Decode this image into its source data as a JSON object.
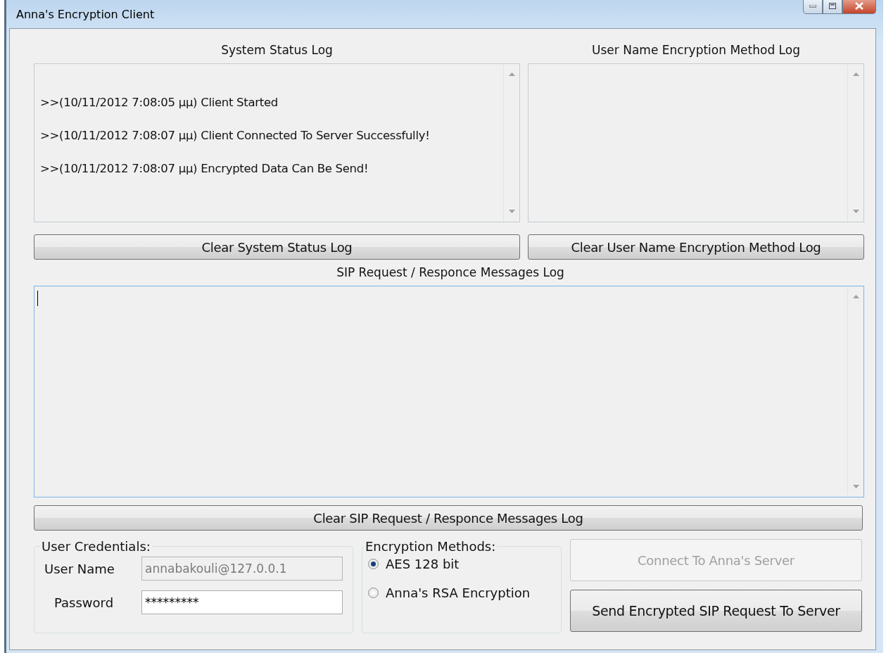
{
  "window": {
    "title": "Anna's Encryption Client"
  },
  "system_log": {
    "title": "System Status Log",
    "lines": [
      ">>(10/11/2012 7:08:05 μμ) Client Started",
      ">>(10/11/2012 7:08:07 μμ) Client Connected To Server Successfully!",
      ">>(10/11/2012 7:08:07 μμ) Encrypted Data Can Be Send!"
    ],
    "clear_button": "Clear System Status Log"
  },
  "method_log": {
    "title": "User Name Encryption Method Log",
    "clear_button": "Clear User Name Encryption Method Log"
  },
  "sip_log": {
    "title": "SIP Request / Responce Messages Log",
    "clear_button": "Clear SIP Request / Responce Messages Log"
  },
  "credentials": {
    "title": "User Credentials:",
    "fields": [
      {
        "label": "User Name",
        "value": "annabakouli@127.0.0.1",
        "disabled": true
      },
      {
        "label": "Password",
        "value": "*********",
        "disabled": false
      }
    ]
  },
  "encryption": {
    "title": "Encryption Methods:",
    "options": [
      {
        "label": "AES 128 bit",
        "selected": true
      },
      {
        "label": "Anna's RSA Encryption",
        "selected": false
      }
    ]
  },
  "actions": [
    {
      "label": "Connect To Anna's Server",
      "disabled": true
    },
    {
      "label": "Send Encrypted SIP Request To Server",
      "disabled": false
    }
  ]
}
